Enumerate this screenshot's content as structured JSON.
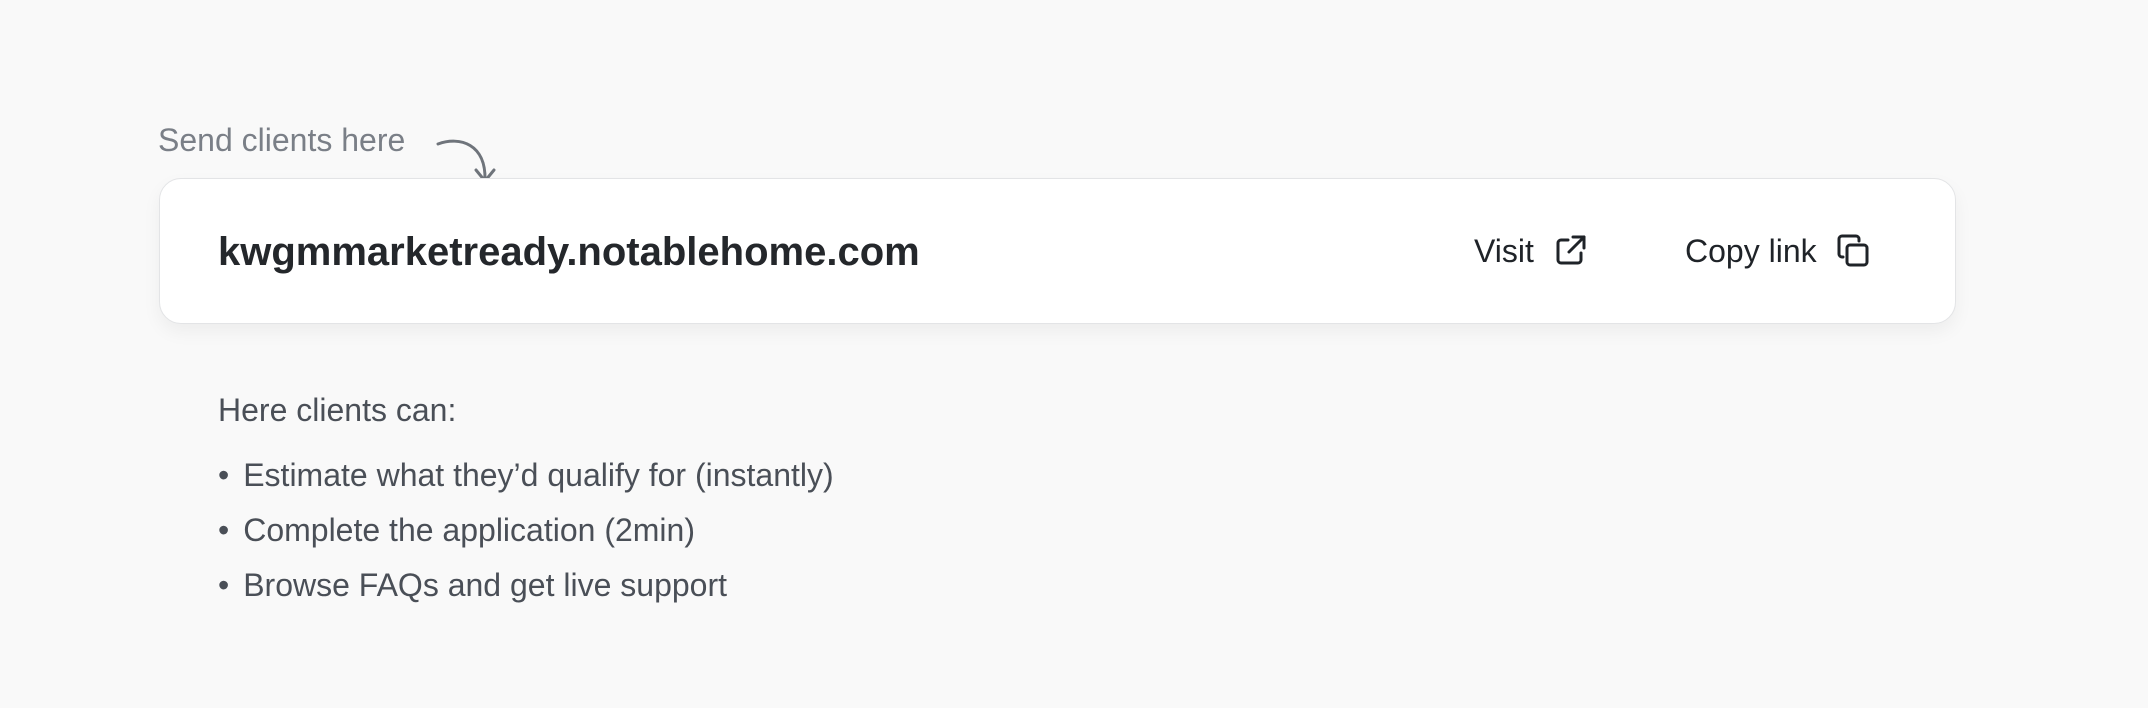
{
  "label": {
    "send_clients": "Send clients here"
  },
  "link_card": {
    "url": "kwgmmarketready.notablehome.com",
    "visit_label": "Visit",
    "visit_icon": "external-link-icon",
    "copy_label": "Copy link",
    "copy_icon": "copy-icon"
  },
  "features": {
    "heading": "Here clients can:",
    "bullet": "•",
    "items": [
      "Estimate what they’d qualify for (instantly)",
      "Complete the application (2min)",
      "Browse FAQs and get live support"
    ]
  },
  "colors": {
    "background": "#f9f9f9",
    "card": "#ffffff",
    "text_primary": "#1f2328",
    "text_muted": "#7a7f87",
    "text_secondary": "#4a4f57"
  }
}
